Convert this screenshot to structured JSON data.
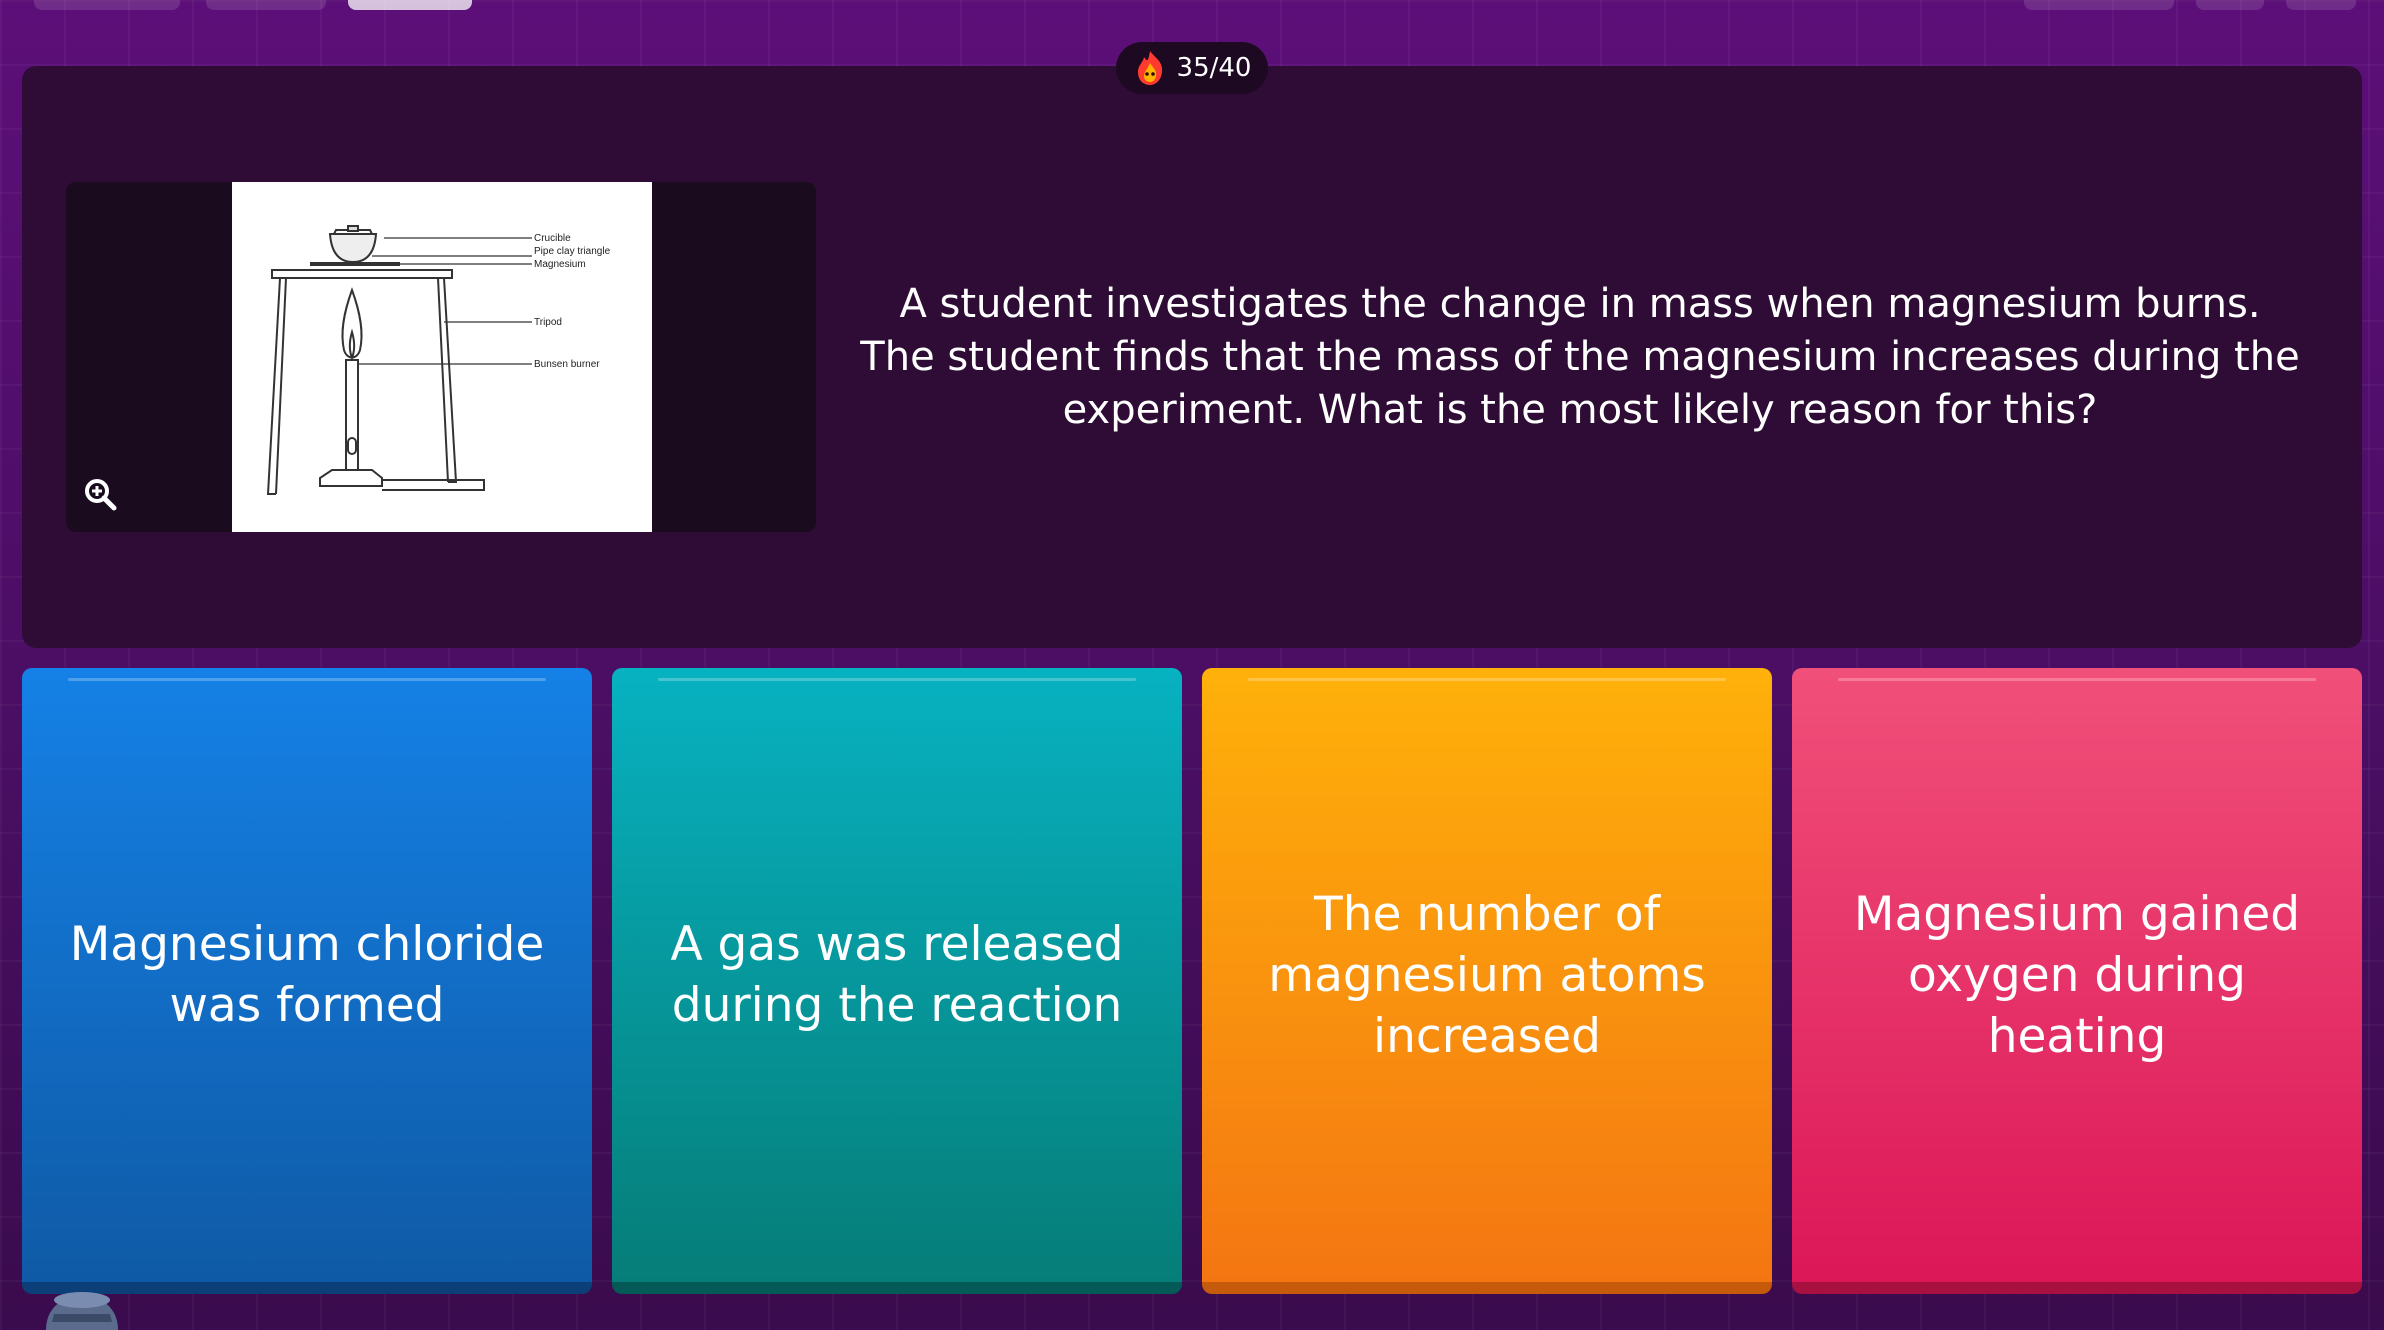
{
  "progress": {
    "counter": "35/40",
    "icon": "fire-mascot-icon"
  },
  "question": {
    "text": "A student investigates the change in mass when magnesium burns. The student finds that the mass of the magnesium increases during the experiment. What is the most likely reason for this?",
    "zoom_icon": "zoom-in-icon",
    "diagram_labels": {
      "crucible": "Crucible",
      "triangle": "Pipe clay triangle",
      "magnesium": "Magnesium",
      "tripod": "Tripod",
      "burner": "Bunsen burner"
    }
  },
  "answers": [
    {
      "label": "Magnesium chloride was formed",
      "color": "#1581e6"
    },
    {
      "label": "A gas was released during the reaction",
      "color": "#07b2c1"
    },
    {
      "label": "The number of magnesium atoms increased",
      "color": "#ffb10a"
    },
    {
      "label": "Magnesium gained oxygen during heating",
      "color": "#f1507a"
    }
  ]
}
